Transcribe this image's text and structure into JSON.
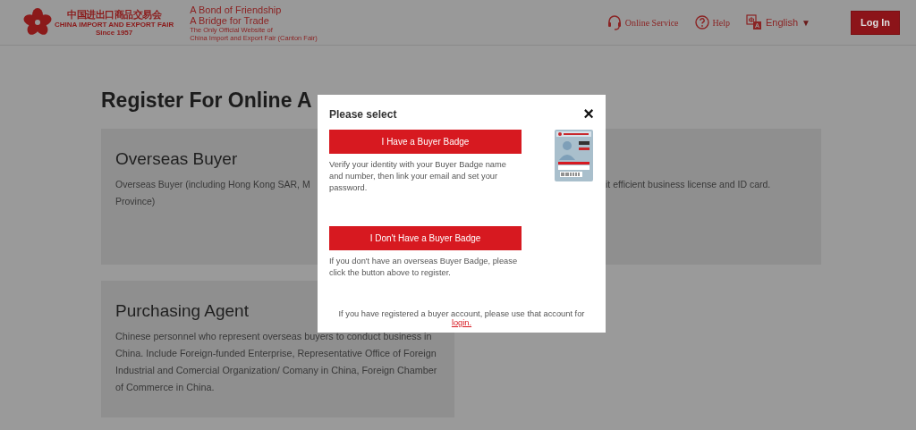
{
  "header": {
    "logo": {
      "chinese": "中国进出口商品交易会",
      "english": "CHINA IMPORT AND EXPORT FAIR",
      "since": "Since 1957"
    },
    "slogans": [
      "A Bond of Friendship",
      "A Bridge for Trade"
    ],
    "tagline": [
      "The Only Official Website of",
      "China Import and Export Fair (Canton Fair)"
    ],
    "nav": [
      {
        "kind": "service",
        "label": "Online Service"
      },
      {
        "kind": "help",
        "label": "Help"
      },
      {
        "kind": "language",
        "label": "English",
        "caret": "▼"
      }
    ],
    "login_button": "Log In"
  },
  "page": {
    "title": "Register For Online A",
    "cards": [
      {
        "title": "Overseas Buyer",
        "fragments": [
          "Overseas Buyer (including Hong Kong SAR, M",
          "it efficient business license and ID card.",
          "Province)"
        ]
      },
      {
        "title": "Purchasing Agent",
        "text": "Chinese personnel who represent overseas buyers to conduct business in China. Include Foreign-funded Enterprise, Representative Office of Foreign Industrial and Comercial Organization/ Comany in China, Foreign Chamber of Commerce in China."
      }
    ]
  },
  "modal": {
    "title": "Please select",
    "close": "×",
    "options": [
      {
        "button": "I Have a Buyer Badge",
        "text": "Verify your identity with your Buyer Badge name and number, then link your email and set your password."
      },
      {
        "button": "I Don't Have a Buyer Badge",
        "text": "If you don't have an overseas Buyer Badge, please click the button above to register."
      }
    ],
    "footer": "If you have registered a buyer account, please use that account for",
    "link": "login."
  }
}
